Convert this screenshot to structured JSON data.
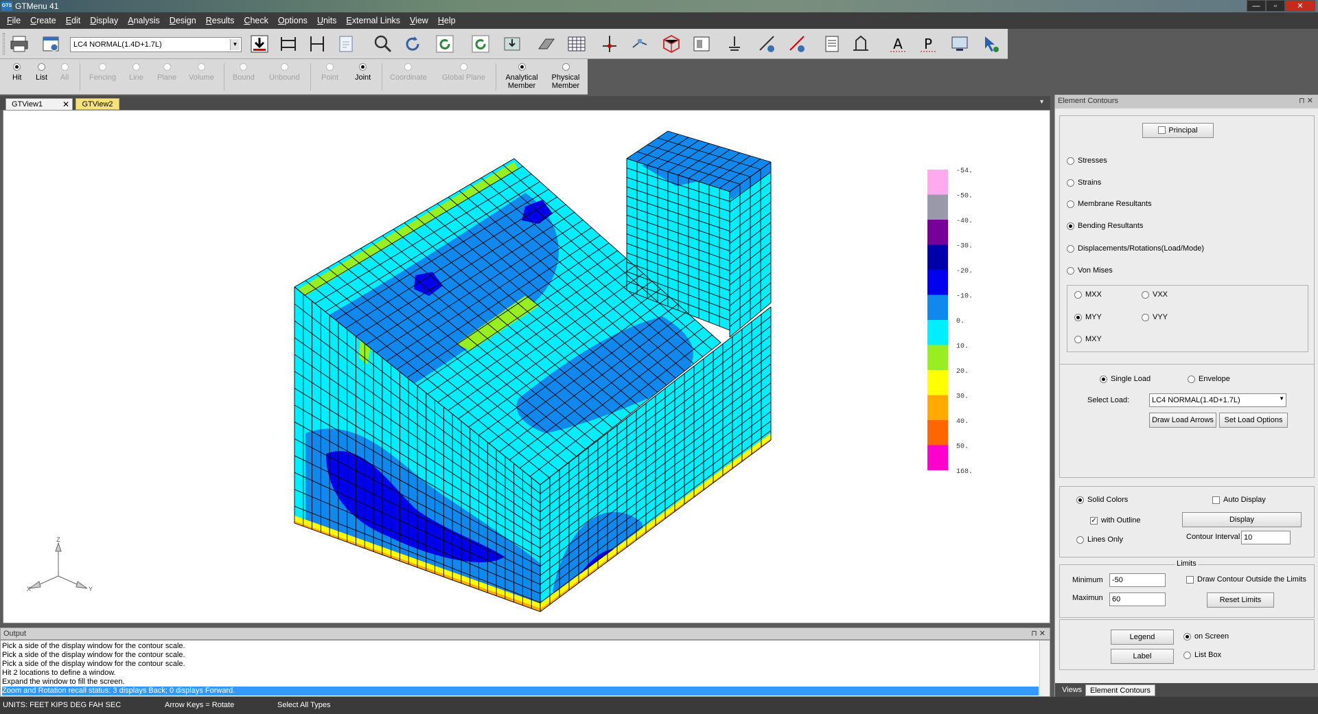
{
  "window": {
    "app_icon": "GTS",
    "title": "GTMenu 41",
    "minimize": "—",
    "restore": "▫",
    "close": "✕"
  },
  "menu": [
    "File",
    "Create",
    "Edit",
    "Display",
    "Analysis",
    "Design",
    "Results",
    "Check",
    "Options",
    "Units",
    "External Links",
    "View",
    "Help"
  ],
  "toolbar": {
    "load_combo": "LC4     NORMAL(1.4D+1.7L)",
    "icons": [
      "print-icon",
      "print-preview-icon",
      "load-case-dropdown",
      "download-icon",
      "frame-icon",
      "dimension-icon",
      "page-icon",
      "zoom-icon",
      "rotate-ccw-icon",
      "rotate-icon",
      "refresh-icon",
      "export-icon",
      "plane-icon",
      "grid-table-icon",
      "axis-icon",
      "node-icon",
      "cube-icon",
      "section-icon",
      "support-icon",
      "member-load-icon",
      "member-load-2-icon",
      "list-icon",
      "structure-icon",
      "text-icon",
      "p-label-icon",
      "monitor-icon",
      "cursor-icon"
    ]
  },
  "selection": [
    {
      "label": "Hit",
      "state": "on",
      "enabled": true
    },
    {
      "label": "List",
      "state": "off",
      "enabled": true
    },
    {
      "label": "All",
      "state": "off",
      "enabled": false
    },
    {
      "label": "Fencing",
      "state": "off",
      "enabled": false
    },
    {
      "label": "Line",
      "state": "off",
      "enabled": false
    },
    {
      "label": "Plane",
      "state": "off",
      "enabled": false
    },
    {
      "label": "Volume",
      "state": "off",
      "enabled": false
    },
    {
      "label": "Bound",
      "state": "off",
      "enabled": false
    },
    {
      "label": "Unbound",
      "state": "off",
      "enabled": false
    },
    {
      "label": "Point",
      "state": "off",
      "enabled": false
    },
    {
      "label": "Joint",
      "state": "on",
      "enabled": true
    },
    {
      "label": "Coordinate",
      "state": "off",
      "enabled": false
    },
    {
      "label": "Global Plane",
      "state": "off",
      "enabled": false
    },
    {
      "label": "Analytical Member",
      "state": "on",
      "enabled": true
    },
    {
      "label": "Physical Member",
      "state": "off",
      "enabled": true
    }
  ],
  "tabs": {
    "view1": "GTView1",
    "view1_close": "✕",
    "view2": "GTView2"
  },
  "legend": {
    "values": [
      "-54.",
      "-50.",
      "-40.",
      "-30.",
      "-20.",
      "-10.",
      "0.",
      "10.",
      "20.",
      "30.",
      "40.",
      "50.",
      "168."
    ],
    "colors": [
      "#ffaaee",
      "#9999aa",
      "#770099",
      "#0000aa",
      "#0000ee",
      "#1188ee",
      "#00eeff",
      "#99ee22",
      "#ffff00",
      "#ffaa00",
      "#ff6600",
      "#ff00cc"
    ]
  },
  "axes": {
    "x": "X",
    "y": "Y",
    "z": "Z"
  },
  "output": {
    "header": "Output",
    "header_icons": "⊓ ✕",
    "lines": [
      "Pick a side of the display window for the contour scale.",
      "Pick a side of the display window for the contour scale.",
      "Pick a side of the display window for the contour scale.",
      "Hit 2 locations to define a window.",
      "Expand the window to fill the screen."
    ],
    "highlight": "Zoom and Rotation recall status:     3 displays Back;     0 displays Forward."
  },
  "status": {
    "units": "UNITS:  FEET  KIPS  DEG   FAH   SEC",
    "keys": "Arrow Keys = Rotate",
    "select": "Select All Types"
  },
  "panel": {
    "title": "Element Contours",
    "title_icons": "⊓ ✕",
    "principal": "Principal",
    "types": [
      "Stresses",
      "Strains",
      "Membrane Resultants",
      "Bending Resultants",
      "Displacements/Rotations(Load/Mode)",
      "Von Mises"
    ],
    "type_selected": 3,
    "components": [
      "MXX",
      "VXX",
      "MYY",
      "VYY",
      "MXY"
    ],
    "component_selected": "MYY",
    "single_load": "Single Load",
    "envelope": "Envelope",
    "select_load_label": "Select Load:",
    "select_load_value": "LC4     NORMAL(1.4D+1.7L)",
    "draw_load_arrows": "Draw Load Arrows",
    "set_load_options": "Set Load Options",
    "solid_colors": "Solid Colors",
    "with_outline": "with Outline",
    "lines_only": "Lines Only",
    "auto_display": "Auto Display",
    "display": "Display",
    "contour_interval_label": "Contour Interval",
    "contour_interval": "10",
    "limits_title": "Limits",
    "minimum_label": "Minimum",
    "minimum": "-50",
    "maximum_label": "Maximun",
    "maximum": "60",
    "draw_outside": "Draw Contour Outside the Limits",
    "reset_limits": "Reset Limits",
    "legend_btn": "Legend",
    "label_btn": "Label",
    "on_screen": "on Screen",
    "list_box": "List Box",
    "bottom_tabs": [
      "Views",
      "Element Contours"
    ]
  }
}
